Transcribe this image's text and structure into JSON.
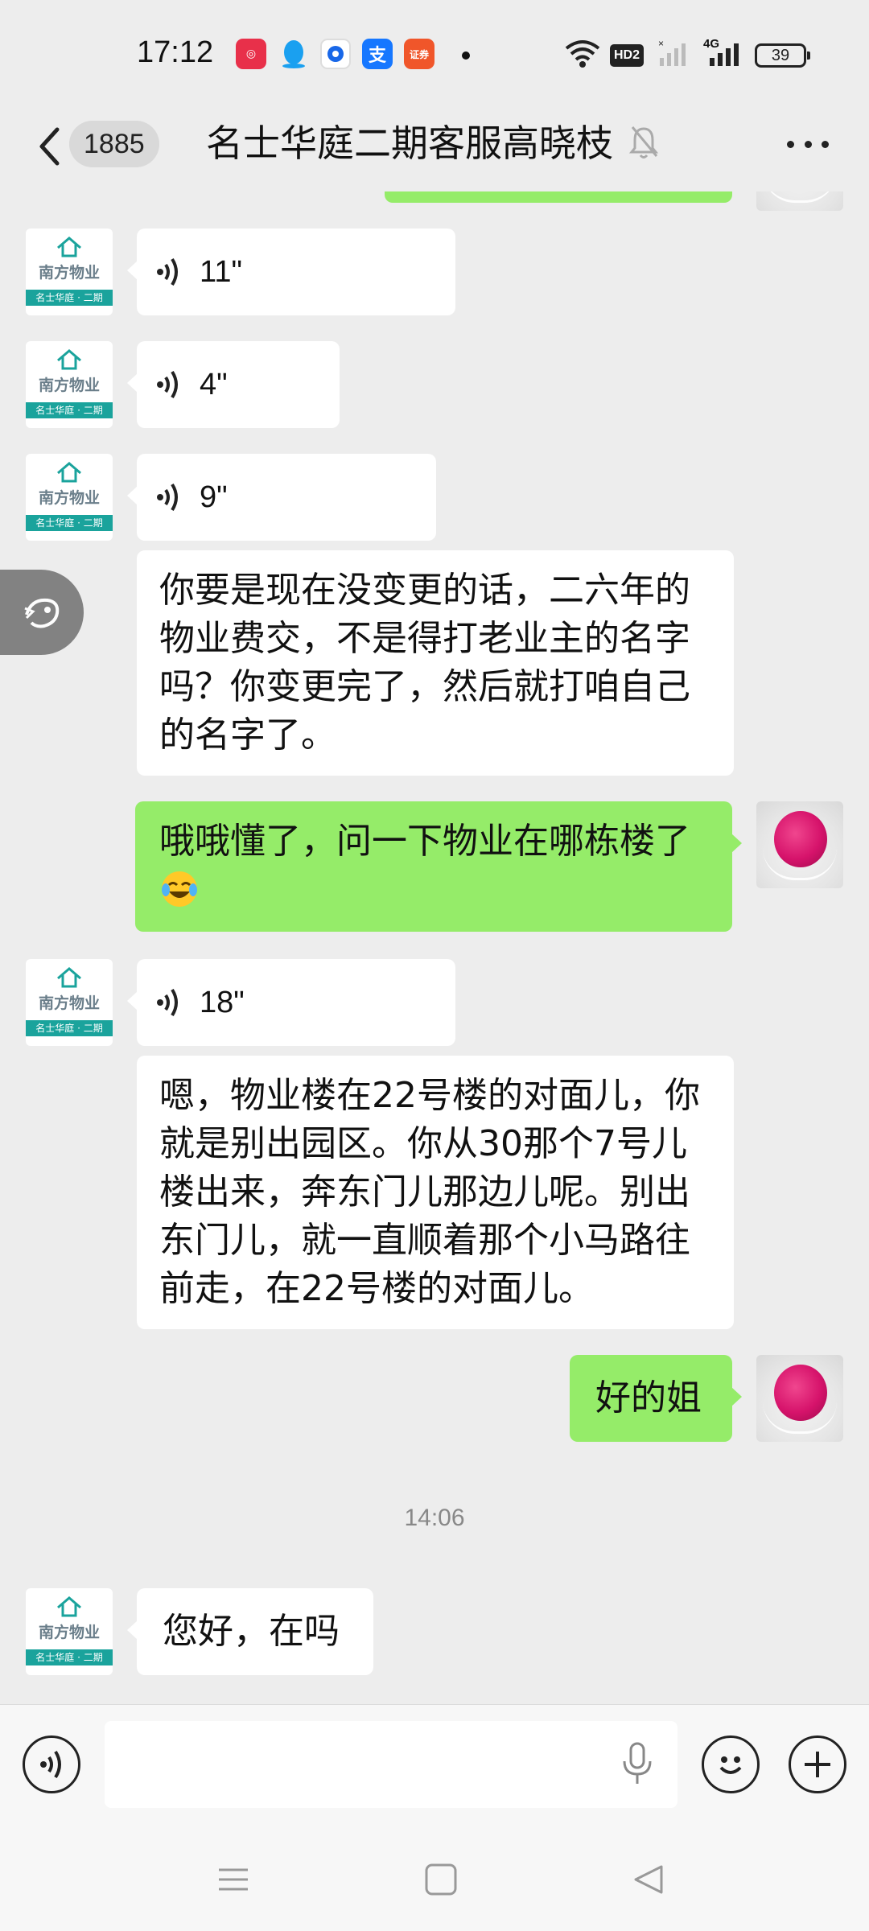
{
  "status_bar": {
    "time": "17:12",
    "network": "4G",
    "hd_badge": "HD2",
    "battery": "39"
  },
  "header": {
    "back_icon": "chevron-left-icon",
    "unread_count": "1885",
    "title": "名士华庭二期客服高晓枝",
    "mute_icon": "bell-off-icon",
    "more_icon": "more-dots-icon"
  },
  "company_avatar": {
    "name": "南方物业",
    "band": "名士华庭 · 二期"
  },
  "messages": [
    {
      "side": "left",
      "type": "voice",
      "duration": "11\""
    },
    {
      "side": "left",
      "type": "voice",
      "duration": "4\""
    },
    {
      "side": "left",
      "type": "voice",
      "duration": "9\""
    },
    {
      "side": "left",
      "type": "text",
      "lines": [
        "你要是现在没变更的话，二六年的",
        "物业费交，不是得打老业主的名字",
        "吗？你变更完了，然后就打咱自己",
        "的名字了。"
      ]
    },
    {
      "side": "right",
      "type": "text",
      "lines": [
        "哦哦懂了，问一下物业在哪栋楼了"
      ],
      "emoji": "laugh-cry-emoji"
    },
    {
      "side": "left",
      "type": "voice",
      "duration": "18\""
    },
    {
      "side": "left",
      "type": "text",
      "lines": [
        "嗯，物业楼在22号楼的对面儿，你",
        "就是别出园区。你从30那个7号儿",
        "楼出来，奔东门儿那边儿呢。别出",
        "东门儿，就一直顺着那个小马路往",
        "前走，在22号楼的对面儿。"
      ]
    },
    {
      "side": "right",
      "type": "text",
      "lines": [
        "好的姐"
      ]
    },
    {
      "side": "left",
      "type": "text",
      "lines": [
        "您好，在吗"
      ]
    }
  ],
  "timestamp": "14:06",
  "input_bar": {
    "voice_icon": "voice-toggle-icon",
    "placeholder": "",
    "mic_icon": "microphone-icon",
    "emoji_icon": "emoji-icon",
    "plus_icon": "plus-icon"
  },
  "nav_bar": {
    "menu_icon": "menu-icon",
    "home_icon": "home-icon",
    "back_icon": "back-triangle-icon"
  },
  "colors": {
    "background": "#ededed",
    "sent_bubble": "#95ec69",
    "received_bubble": "#ffffff",
    "logo_teal": "#1aa39c"
  }
}
